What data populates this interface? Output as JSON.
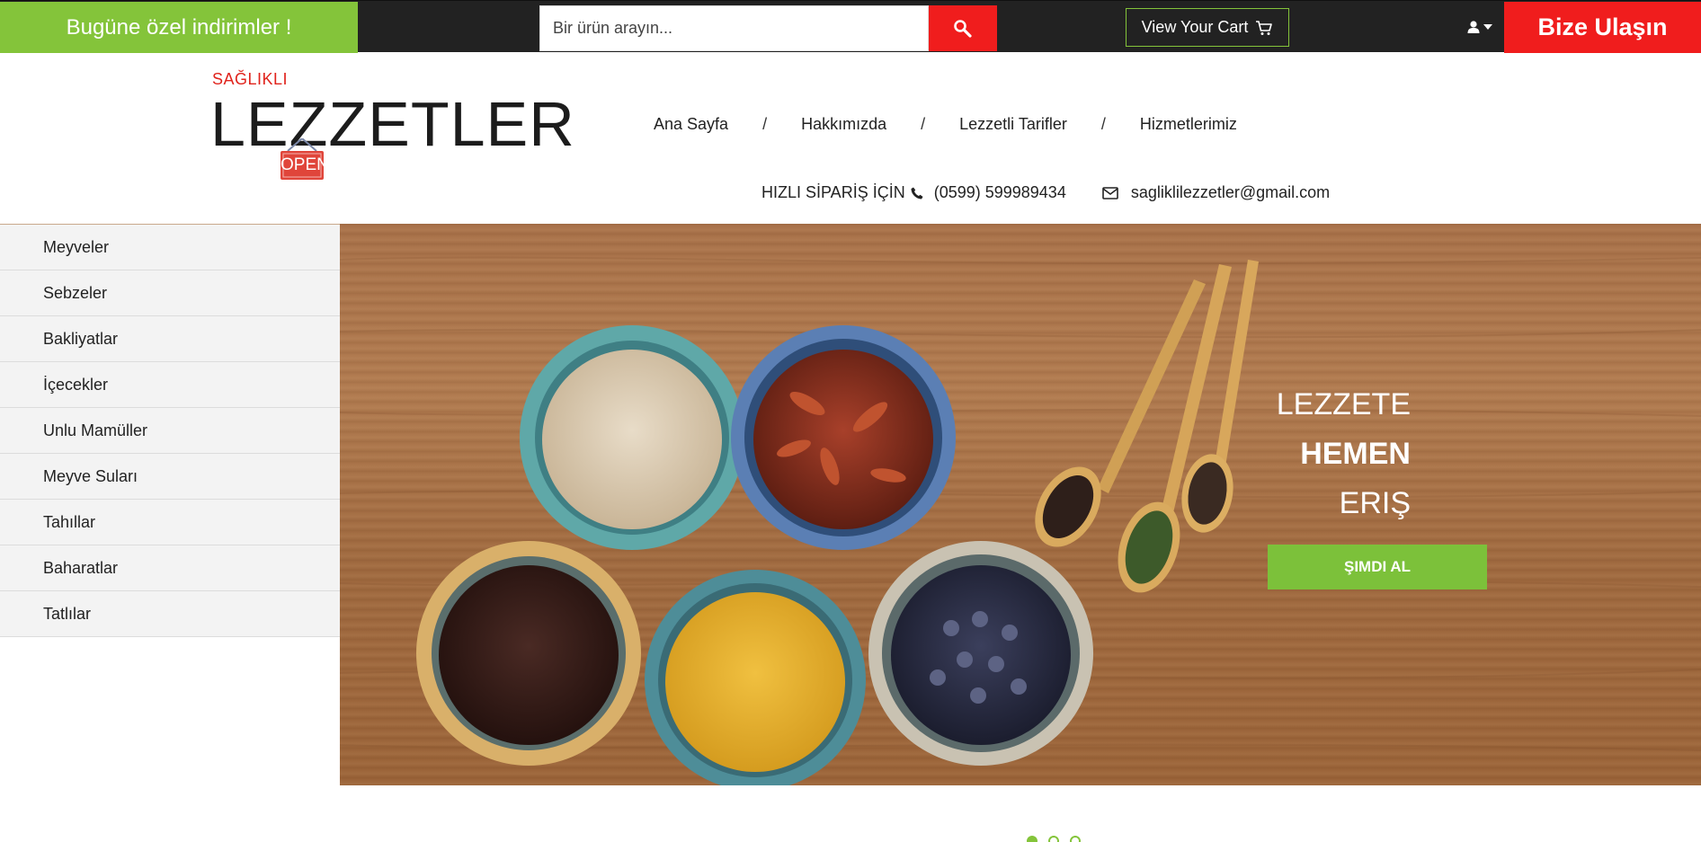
{
  "topbar": {
    "promo": "Bugüne özel indirimler !",
    "search_placeholder": "Bir ürün arayın...",
    "cart_label": "View Your Cart",
    "contact_label": "Bize Ulaşın"
  },
  "logo": {
    "small": "SAĞLIKLI",
    "big": "LEZZETLER",
    "sign": "OPEN"
  },
  "nav": {
    "items": [
      "Ana Sayfa",
      "Hakkımızda",
      "Lezzetli Tarifler",
      "Hizmetlerimiz"
    ],
    "separator": "/"
  },
  "contact": {
    "label": "HIZLI SİPARİŞ İÇİN",
    "phone": "(0599) 599989434",
    "email": "sagliklilezzetler@gmail.com"
  },
  "sidebar": {
    "items": [
      "Meyveler",
      "Sebzeler",
      "Bakliyatlar",
      "İçecekler",
      "Unlu Mamüller",
      "Meyve Suları",
      "Tahıllar",
      "Baharatlar",
      "Tatlılar"
    ]
  },
  "hero": {
    "line1": "LEZZETE",
    "line2": "HEMEN",
    "line3": "ERIŞ",
    "cta": "ŞIMDI AL"
  },
  "slider": {
    "count": 3,
    "active": 1
  },
  "colors": {
    "green": "#84c43a",
    "red": "#f01d1d",
    "dark": "#222222"
  }
}
